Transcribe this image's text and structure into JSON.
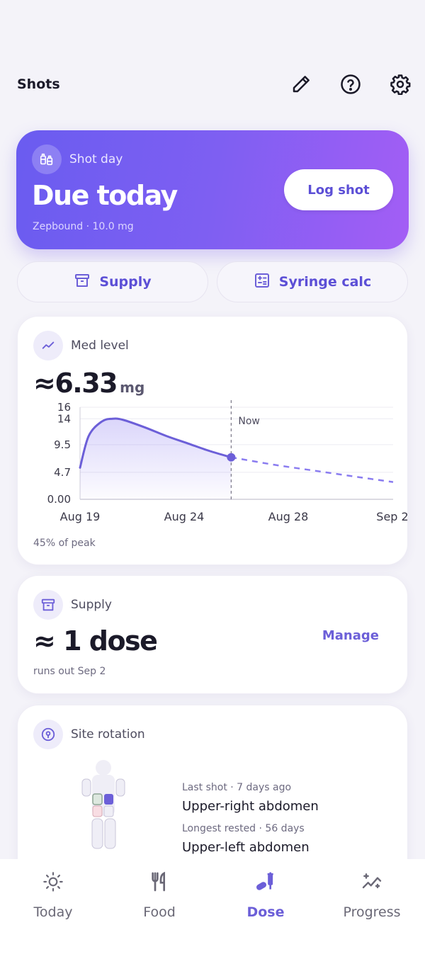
{
  "header": {
    "title": "Shots"
  },
  "hero": {
    "label": "Shot day",
    "title": "Due today",
    "subtitle": "Zepbound · 10.0 mg",
    "button": "Log shot"
  },
  "pills": {
    "supply": "Supply",
    "syringe": "Syringe calc"
  },
  "med_level": {
    "label": "Med level",
    "value": "≈6.33",
    "unit": "mg",
    "footer": "45% of peak",
    "now_label": "Now"
  },
  "supply": {
    "label": "Supply",
    "value": "≈ 1 dose",
    "footer": "runs out Sep 2",
    "manage": "Manage"
  },
  "site": {
    "label": "Site rotation",
    "last_label": "Last shot · 7 days ago",
    "last_value": "Upper-right abdomen",
    "rested_label": "Longest rested · 56 days",
    "rested_value": "Upper-left abdomen"
  },
  "nav": {
    "today": "Today",
    "food": "Food",
    "dose": "Dose",
    "progress": "Progress"
  },
  "colors": {
    "accent": "#6c5fd8",
    "gradient_start": "#6a5cf0",
    "gradient_end": "#a35ef5"
  },
  "chart_data": {
    "type": "area",
    "x_tick_labels": [
      "Aug 19",
      "Aug 24",
      "Aug 28",
      "Sep 2"
    ],
    "y_tick_labels": [
      "16",
      "14",
      "9.5",
      "4.7",
      "0.00"
    ],
    "ylim": [
      0,
      16
    ],
    "now_marker": "Now",
    "series": [
      {
        "style": "solid-area",
        "x": [
          0,
          0.4,
          1,
          1.5,
          2,
          3,
          4,
          5,
          6,
          7
        ],
        "y": [
          5.5,
          11.0,
          13.5,
          14.0,
          13.8,
          12.5,
          11.0,
          9.7,
          8.4,
          7.3
        ]
      },
      {
        "style": "dashed-projection",
        "x": [
          7,
          9,
          11,
          13,
          14.5
        ],
        "y": [
          7.3,
          6.0,
          4.9,
          3.8,
          3.0
        ]
      }
    ],
    "current_point": {
      "x": 7,
      "y": 6.33
    }
  }
}
